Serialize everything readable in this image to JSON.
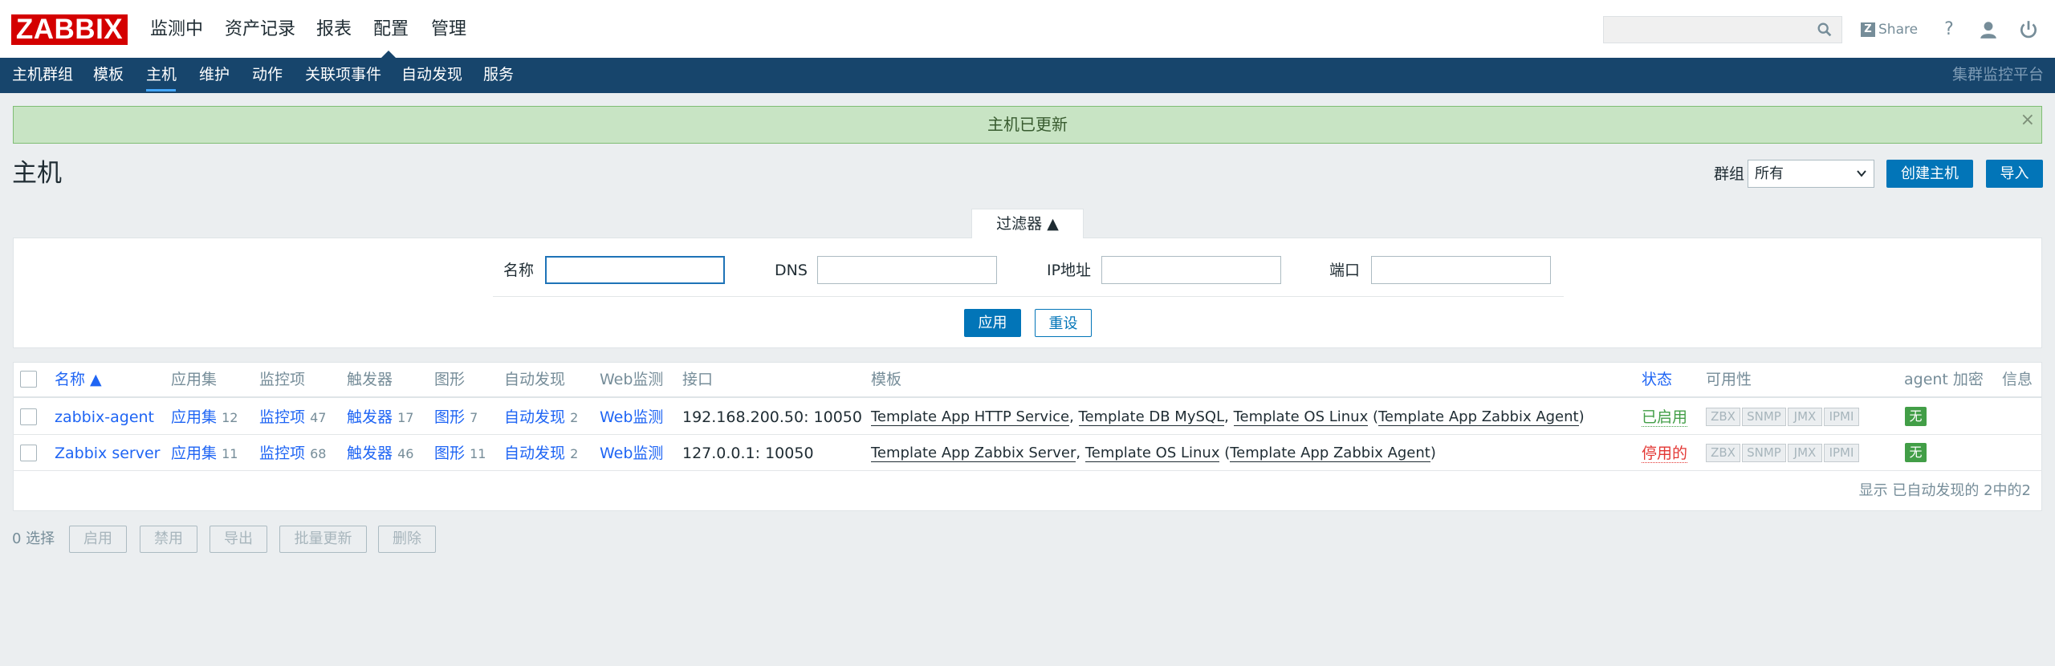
{
  "brand": {
    "logo_text": "ZABBIX",
    "logo_color": "#d40000"
  },
  "main_nav": [
    {
      "label": "监测中"
    },
    {
      "label": "资产记录"
    },
    {
      "label": "报表"
    },
    {
      "label": "配置",
      "active": true
    },
    {
      "label": "管理"
    }
  ],
  "header": {
    "search_placeholder": "",
    "share_label": "Share",
    "share_badge": "Z",
    "help_label": "?"
  },
  "sub_nav": {
    "items": [
      {
        "label": "主机群组"
      },
      {
        "label": "模板"
      },
      {
        "label": "主机",
        "active": true
      },
      {
        "label": "维护"
      },
      {
        "label": "动作"
      },
      {
        "label": "关联项事件"
      },
      {
        "label": "自动发现"
      },
      {
        "label": "服务"
      }
    ],
    "right_label": "集群监控平台"
  },
  "message": {
    "text": "主机已更新",
    "close_label": "×"
  },
  "page": {
    "title": "主机",
    "group_label": "群组",
    "group_value": "所有",
    "create_button": "创建主机",
    "import_button": "导入"
  },
  "filter": {
    "tab_label": "过滤器 ▲",
    "name_label": "名称",
    "name_value": "",
    "dns_label": "DNS",
    "dns_value": "",
    "ip_label": "IP地址",
    "ip_value": "",
    "port_label": "端口",
    "port_value": "",
    "apply_button": "应用",
    "reset_button": "重设"
  },
  "table": {
    "headers": {
      "name": "名称 ▲",
      "applications": "应用集",
      "items": "监控项",
      "triggers": "触发器",
      "graphs": "图形",
      "discovery": "自动发现",
      "web": "Web监测",
      "interface": "接口",
      "templates": "模板",
      "status": "状态",
      "availability": "可用性",
      "encryption": "agent 加密",
      "info": "信息"
    },
    "rows": [
      {
        "name": "zabbix-agent",
        "applications_label": "应用集",
        "applications_count": "12",
        "items_label": "监控项",
        "items_count": "47",
        "triggers_label": "触发器",
        "triggers_count": "17",
        "graphs_label": "图形",
        "graphs_count": "7",
        "discovery_label": "自动发现",
        "discovery_count": "2",
        "web_label": "Web监测",
        "interface": "192.168.200.50: 10050",
        "templates": [
          "Template App HTTP Service",
          "Template DB MySQL",
          "Template OS Linux"
        ],
        "parent_template": "Template App Zabbix Agent",
        "status": "已启用",
        "availability": [
          "ZBX",
          "SNMP",
          "JMX",
          "IPMI"
        ],
        "encryption": "无"
      },
      {
        "name": "Zabbix server",
        "applications_label": "应用集",
        "applications_count": "11",
        "items_label": "监控项",
        "items_count": "68",
        "triggers_label": "触发器",
        "triggers_count": "46",
        "graphs_label": "图形",
        "graphs_count": "11",
        "discovery_label": "自动发现",
        "discovery_count": "2",
        "web_label": "Web监测",
        "interface": "127.0.0.1: 10050",
        "templates": [
          "Template App Zabbix Server",
          "Template OS Linux"
        ],
        "parent_template": "Template App Zabbix Agent",
        "status": "停用的",
        "availability": [
          "ZBX",
          "SNMP",
          "JMX",
          "IPMI"
        ],
        "encryption": "无"
      }
    ],
    "footer": "显示 已自动发现的 2中的2"
  },
  "actions": {
    "selected": "0 选择",
    "enable": "启用",
    "disable": "禁用",
    "export": "导出",
    "mass_update": "批量更新",
    "delete": "删除"
  },
  "colors": {
    "nav_bg": "#17456c",
    "accent": "#0275b8",
    "success_bg": "#c8e4c4",
    "enabled": "#429e47",
    "disabled": "#e33734"
  }
}
